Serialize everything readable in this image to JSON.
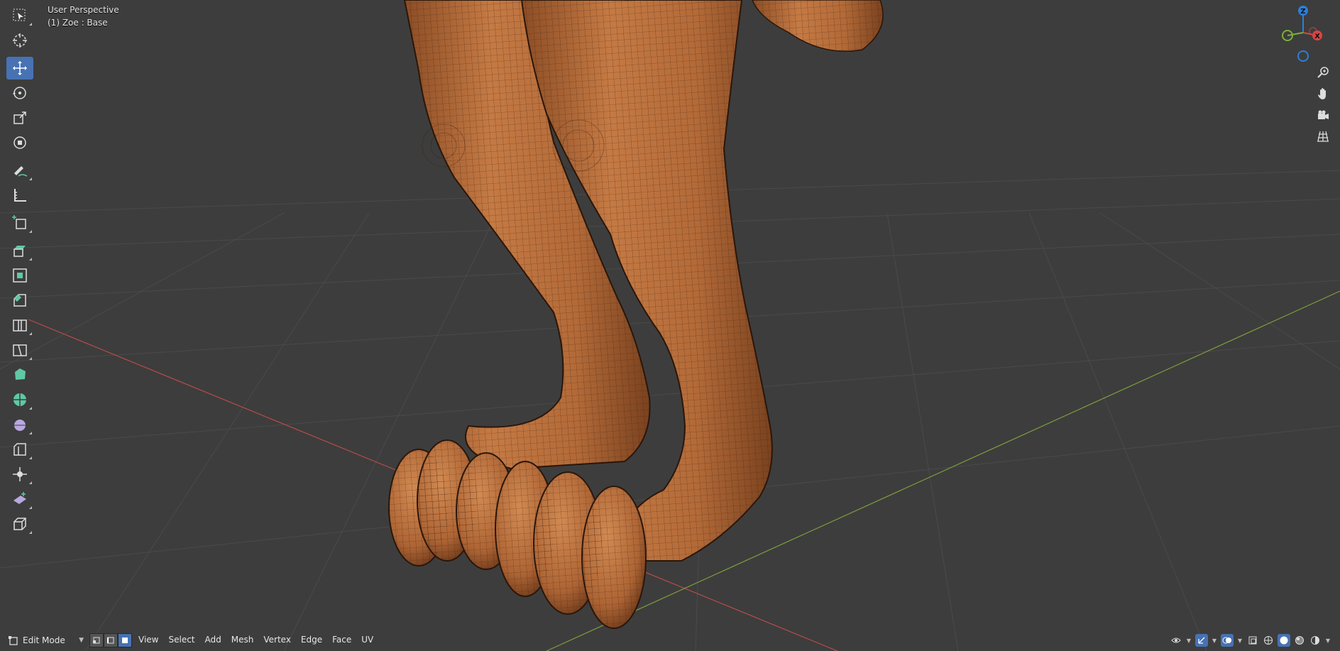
{
  "viewport": {
    "view_name": "User Perspective",
    "object_info": "(1) Zoe  : Base",
    "background": "#3d3d3d",
    "mesh_color": "#b76a3a",
    "x_axis_color": "#b84a4a",
    "y_axis_color": "#7d9f3c"
  },
  "toolbar": {
    "tools": [
      {
        "name": "select-box-tool",
        "icon": "select-box-icon",
        "active": false
      },
      {
        "name": "cursor-tool",
        "icon": "cursor-icon",
        "active": false
      },
      {
        "name": "move-tool",
        "icon": "move-icon",
        "active": true
      },
      {
        "name": "rotate-tool",
        "icon": "rotate-icon",
        "active": false
      },
      {
        "name": "scale-tool",
        "icon": "scale-icon",
        "active": false
      },
      {
        "name": "transform-tool",
        "icon": "transform-icon",
        "active": false
      },
      {
        "name": "annotate-tool",
        "icon": "annotate-icon",
        "active": false
      },
      {
        "name": "measure-tool",
        "icon": "measure-icon",
        "active": false
      },
      {
        "name": "add-cube-tool",
        "icon": "add-cube-icon",
        "active": false
      },
      {
        "name": "extrude-tool",
        "icon": "extrude-icon",
        "active": false
      },
      {
        "name": "inset-tool",
        "icon": "inset-icon",
        "active": false
      },
      {
        "name": "bevel-tool",
        "icon": "bevel-icon",
        "active": false
      },
      {
        "name": "loop-cut-tool",
        "icon": "loop-cut-icon",
        "active": false
      },
      {
        "name": "knife-tool",
        "icon": "knife-icon",
        "active": false
      },
      {
        "name": "poly-build-tool",
        "icon": "poly-build-icon",
        "active": false
      },
      {
        "name": "spin-tool",
        "icon": "spin-icon",
        "active": false
      },
      {
        "name": "smooth-tool",
        "icon": "smooth-icon",
        "active": false
      },
      {
        "name": "edge-slide-tool",
        "icon": "edge-slide-icon",
        "active": false
      },
      {
        "name": "shrink-fatten-tool",
        "icon": "shrink-fatten-icon",
        "active": false
      },
      {
        "name": "shear-tool",
        "icon": "shear-icon",
        "active": false
      },
      {
        "name": "rip-tool",
        "icon": "rip-icon",
        "active": false
      }
    ]
  },
  "navigator": {
    "z_label": "Z",
    "x_label": "X",
    "z_color": "#2d7fd6",
    "x_color": "#d84545",
    "y_color": "#7bb03a"
  },
  "nav_buttons": [
    "zoom-icon",
    "hand-pan-icon",
    "camera-icon",
    "grid-icon"
  ],
  "header": {
    "mode": "Edit Mode",
    "menus": [
      "View",
      "Select",
      "Add",
      "Mesh",
      "Vertex",
      "Edge",
      "Face",
      "UV"
    ],
    "accent": "#4772b3"
  }
}
